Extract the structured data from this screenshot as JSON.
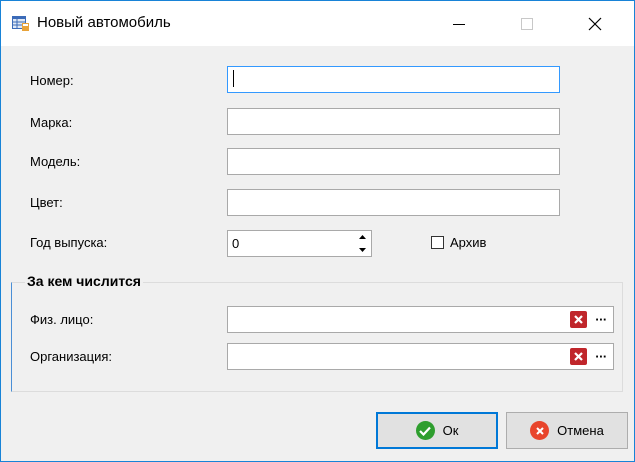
{
  "window": {
    "title": "Новый автомобиль",
    "icon": "database-table-icon"
  },
  "form": {
    "number_label": "Номер:",
    "number_value": "",
    "brand_label": "Марка:",
    "brand_value": "",
    "model_label": "Модель:",
    "model_value": "",
    "color_label": "Цвет:",
    "color_value": "",
    "year_label": "Год выпуска:",
    "year_value": "0",
    "archive_label": "Архив",
    "archive_checked": false
  },
  "owner_group": {
    "title": "За кем числится",
    "person_label": "Физ. лицо:",
    "person_value": "",
    "organization_label": "Организация:",
    "organization_value": "",
    "browse_label": "···"
  },
  "buttons": {
    "ok_label": "Ок",
    "cancel_label": "Отмена"
  },
  "colors": {
    "accent": "#0078d7",
    "clear_red": "#c0262b",
    "ok_green": "#2e9e2e",
    "cancel_red": "#e8452c"
  }
}
